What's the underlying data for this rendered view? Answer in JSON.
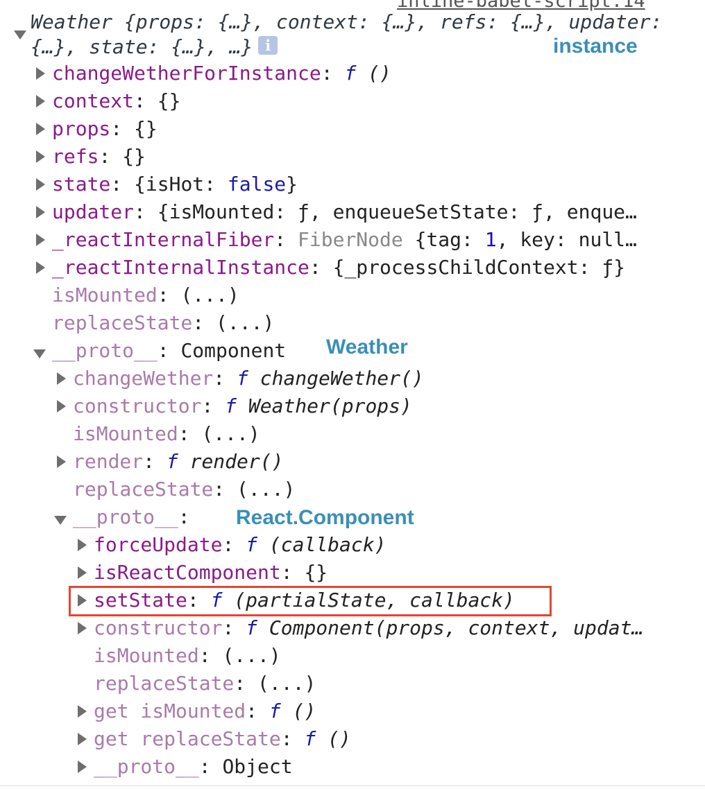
{
  "source_link": "inline-babel-script:14",
  "header": {
    "summary": "Weather {props: {…}, context: {…}, refs: {…}, updater: {…}, state: {…}, …}",
    "info_icon": "info-icon"
  },
  "annotations": {
    "instance": "instance",
    "weather": "Weather",
    "react_component": "React.Component"
  },
  "rows": {
    "r1_key": "changeWetherForInstance",
    "r1_f": "f",
    "r1_val": "()",
    "r2_key": "context",
    "r2_val": "{}",
    "r3_key": "props",
    "r3_val": "{}",
    "r4_key": "refs",
    "r4_val": "{}",
    "r5_key": "state",
    "r5_open": "{isHot: ",
    "r5_bool": "false",
    "r5_close": "}",
    "r6_key": "updater",
    "r6_val": "{isMounted: ƒ, enqueueSetState: ƒ, enque…",
    "r7_key": "_reactInternalFiber",
    "r7_type": "FiberNode",
    "r7_open": " {tag: ",
    "r7_num": "1",
    "r7_rest": ", key: null…",
    "r8_key": "_reactInternalInstance",
    "r8_val": "{_processChildContext: ƒ}",
    "r9_key": "isMounted",
    "r9_val": "(...)",
    "r10_key": "replaceState",
    "r10_val": "(...)",
    "r11_key": "__proto__",
    "r11_val": "Component",
    "r12_key": "changeWether",
    "r12_f": "f",
    "r12_val": "changeWether()",
    "r13_key": "constructor",
    "r13_f": "f",
    "r13_val": "Weather(props)",
    "r14_key": "isMounted",
    "r14_val": "(...)",
    "r15_key": "render",
    "r15_f": "f",
    "r15_val": "render()",
    "r16_key": "replaceState",
    "r16_val": "(...)",
    "r17_key": "__proto__",
    "r18_key": "forceUpdate",
    "r18_f": "f",
    "r18_val": "(callback)",
    "r19_key": "isReactComponent",
    "r19_val": "{}",
    "r20_key": "setState",
    "r20_f": "f",
    "r20_val": "(partialState, callback)",
    "r21_key": "constructor",
    "r21_f": "f",
    "r21_val": "Component(props, context, updat…",
    "r22_key": "isMounted",
    "r22_val": "(...)",
    "r23_key": "replaceState",
    "r23_val": "(...)",
    "r24_key": "get isMounted",
    "r24_f": "f",
    "r24_val": "()",
    "r25_key": "get replaceState",
    "r25_f": "f",
    "r25_val": "()",
    "r26_key": "__proto__",
    "r26_val": "Object"
  },
  "colors": {
    "key": "#8b1a8b",
    "dim_key": "#a97aa9",
    "function": "#1a1aa6",
    "annotation": "#3a8fb7",
    "highlight_border": "#e8442e"
  }
}
